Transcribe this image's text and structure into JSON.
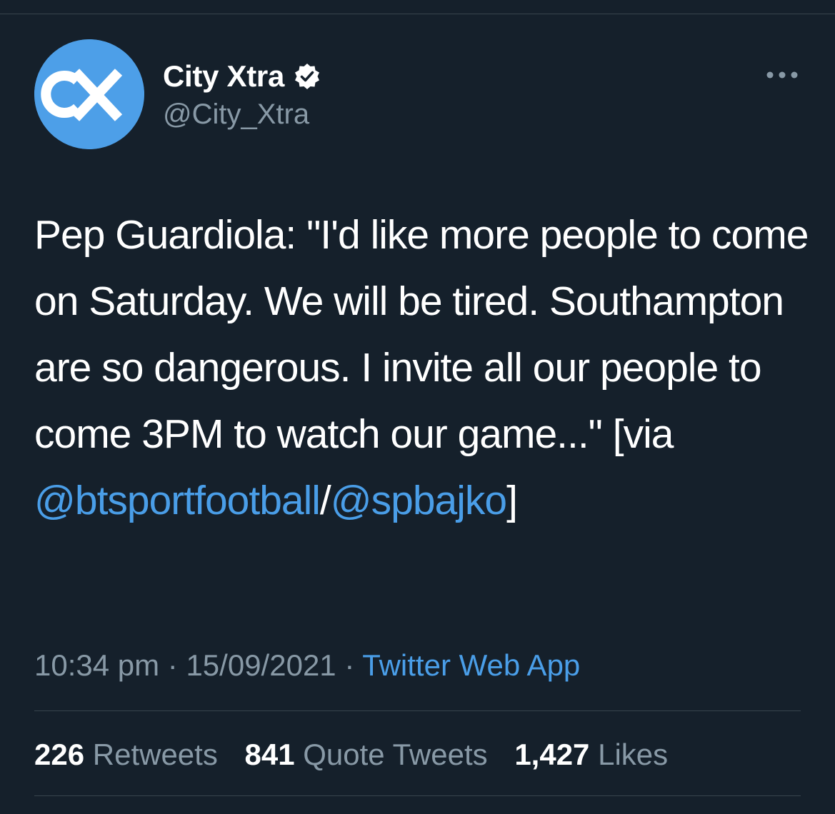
{
  "author": {
    "display_name": "City Xtra",
    "handle": "@City_Xtra",
    "verified": true,
    "avatar_icon": "city-xtra-cx-logo",
    "avatar_color": "#4d9fe8"
  },
  "more_icon": "ellipsis-icon",
  "tweet": {
    "text_main": "Pep Guardiola: \"I'd like more people to come on Saturday. We will be tired. Southampton are so dangerous. I invite all our people to come 3PM to watch our game...\" [via ",
    "mention_1": "@btsportfootball",
    "separator": "/",
    "mention_2": "@spbajko",
    "text_end": "]"
  },
  "meta": {
    "time": "10:34 pm",
    "dot_1": " · ",
    "date": "15/09/2021",
    "dot_2": " · ",
    "source": "Twitter Web App"
  },
  "stats": {
    "retweets_count": "226",
    "retweets_label": "Retweets",
    "quotes_count": "841",
    "quotes_label": "Quote Tweets",
    "likes_count": "1,427",
    "likes_label": "Likes"
  },
  "colors": {
    "background": "#15202b",
    "link": "#4a9ee8",
    "secondary_text": "#8899a6",
    "divider": "#38444d"
  }
}
